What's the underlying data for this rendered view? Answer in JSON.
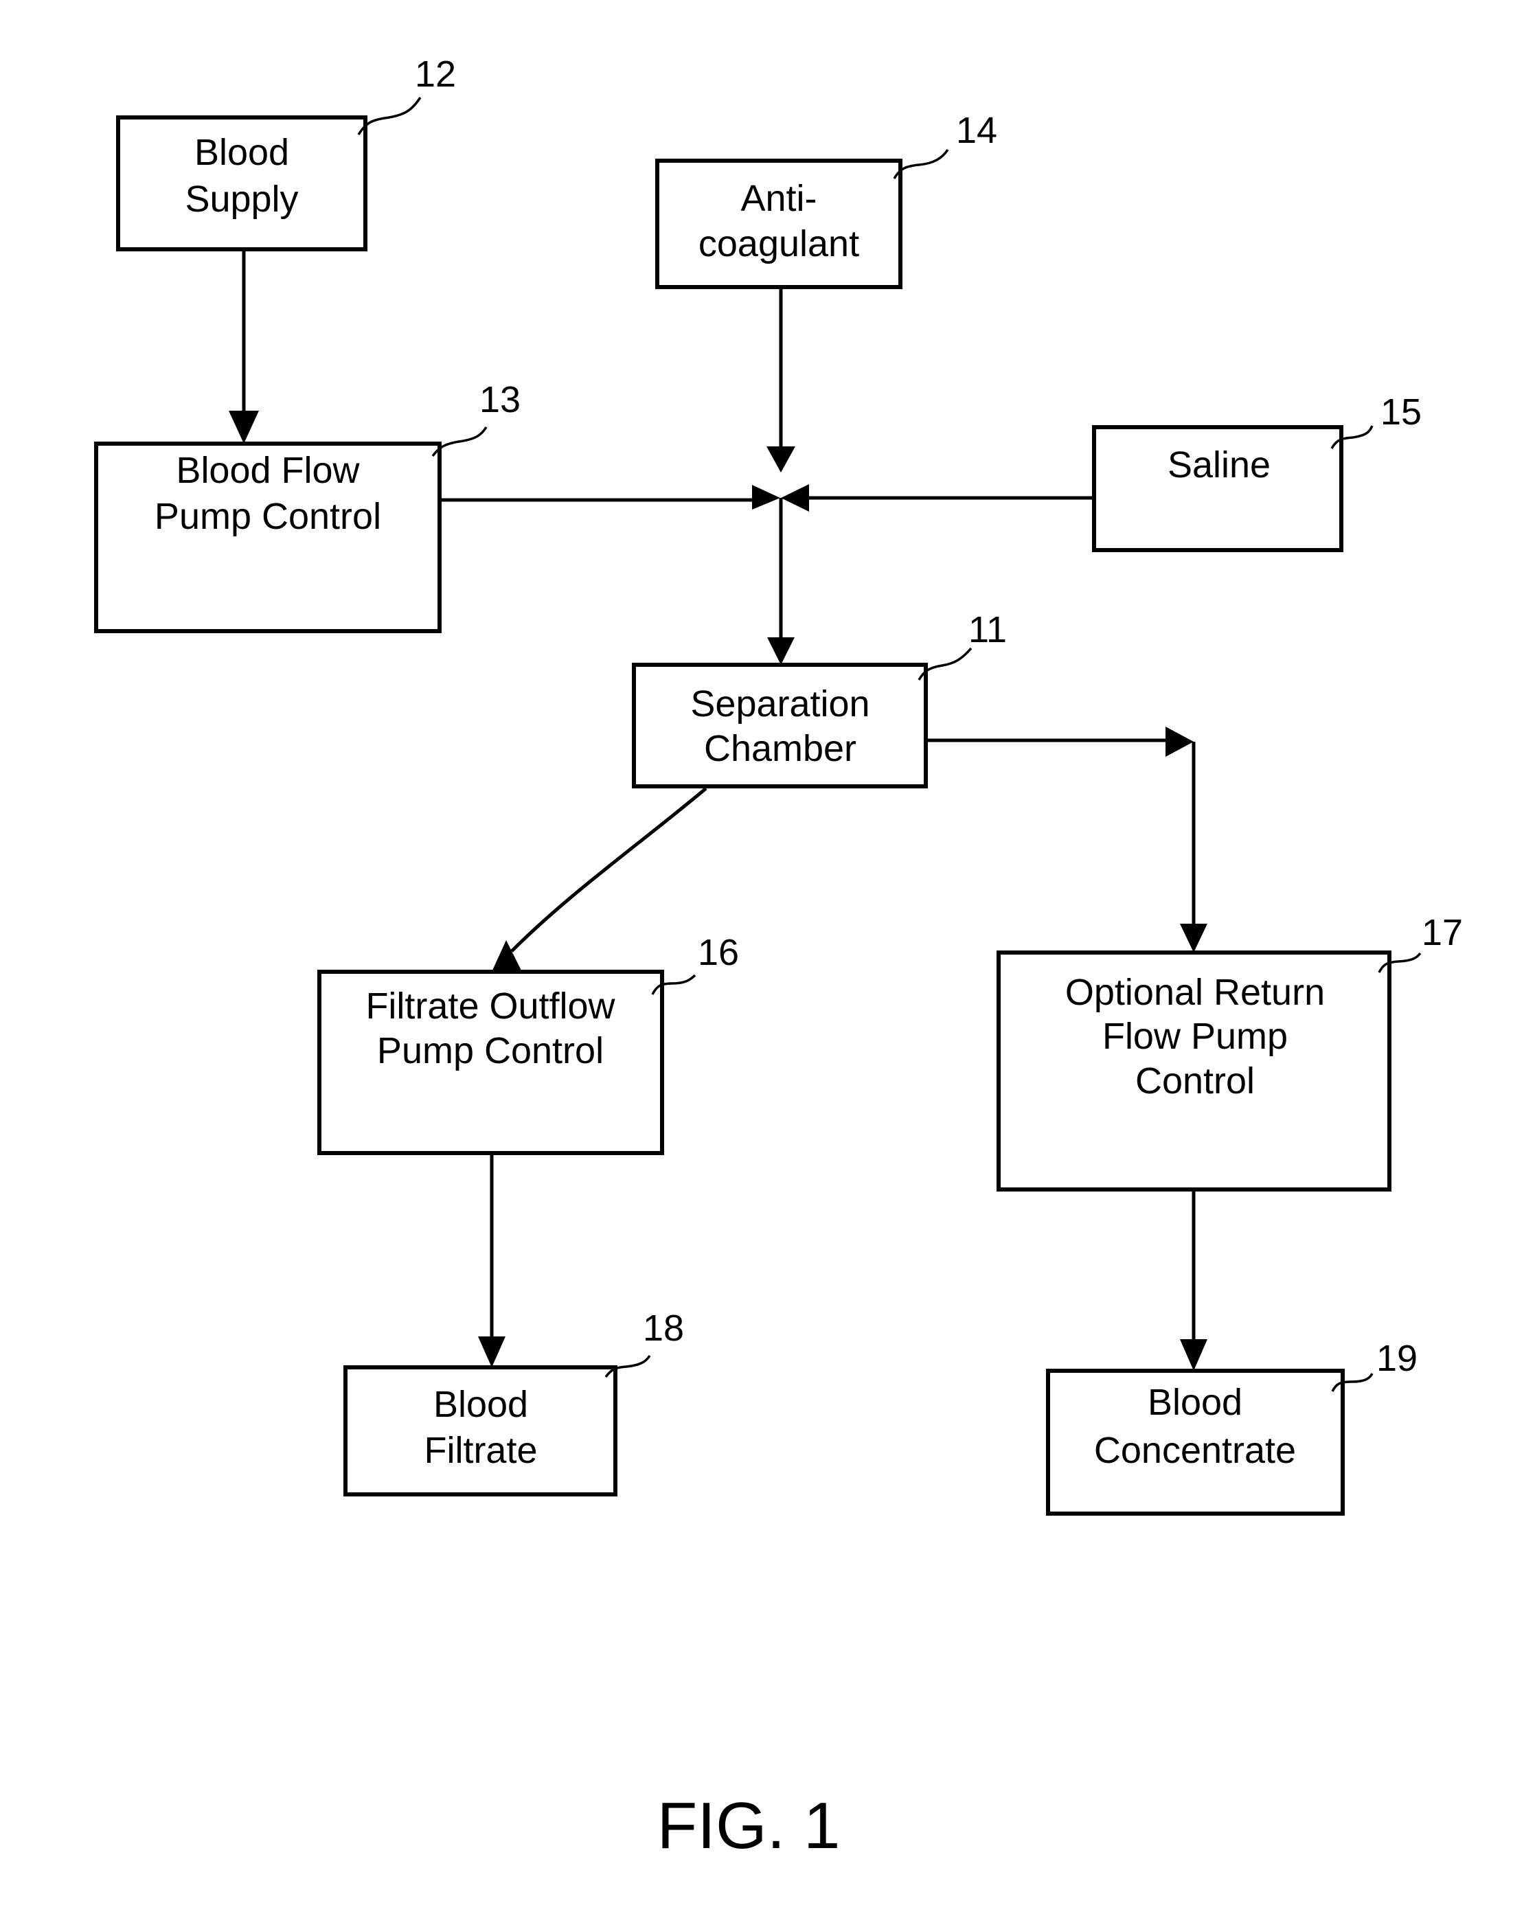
{
  "figure": {
    "caption": "FIG. 1",
    "nodes": [
      {
        "id": "12",
        "ref": "12",
        "lines": [
          "Blood",
          "Supply"
        ]
      },
      {
        "id": "13",
        "ref": "13",
        "lines": [
          "Blood Flow",
          "Pump Control"
        ]
      },
      {
        "id": "14",
        "ref": "14",
        "lines": [
          "Anti-",
          "coagulant"
        ]
      },
      {
        "id": "15",
        "ref": "15",
        "lines": [
          "Saline"
        ]
      },
      {
        "id": "11",
        "ref": "11",
        "lines": [
          "Separation",
          "Chamber"
        ]
      },
      {
        "id": "16",
        "ref": "16",
        "lines": [
          "Filtrate Outflow",
          "Pump Control"
        ]
      },
      {
        "id": "17",
        "ref": "17",
        "lines": [
          "Optional Return",
          "Flow Pump",
          "Control"
        ]
      },
      {
        "id": "18",
        "ref": "18",
        "lines": [
          "Blood",
          "Filtrate"
        ]
      },
      {
        "id": "19",
        "ref": "19",
        "lines": [
          "Blood",
          "Concentrate"
        ]
      }
    ],
    "edges": [
      {
        "from": "12",
        "to": "13"
      },
      {
        "from": "13",
        "to": "junction"
      },
      {
        "from": "14",
        "to": "junction"
      },
      {
        "from": "15",
        "to": "junction"
      },
      {
        "from": "junction",
        "to": "11"
      },
      {
        "from": "11",
        "to": "16"
      },
      {
        "from": "11",
        "to": "17"
      },
      {
        "from": "16",
        "to": "18"
      },
      {
        "from": "17",
        "to": "19"
      }
    ]
  }
}
